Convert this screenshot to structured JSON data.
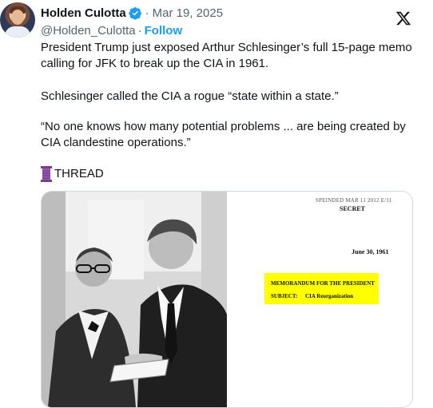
{
  "author": {
    "name": "Holden Culotta",
    "handle": "@Holden_Culotta",
    "date": "Mar 19, 2025",
    "follow_label": "Follow",
    "separator": "·"
  },
  "tweet": {
    "p1": "President Trump just exposed Arthur Schlesinger’s full 15-page memo calling for JFK to break up the CIA in 1961.",
    "p2": "Schlesinger called the CIA a rogue “state within a state.”",
    "p3": "“No one knows how many potential problems ... are being created by CIA clandestine operations.”",
    "thread": "THREAD"
  },
  "media": {
    "doc_header": "SPEINDED MAR 11 2012 E/11",
    "classification": "SECRET",
    "doc_date": "June 30, 1961",
    "memo_title": "MEMORANDUM FOR THE PRESIDENT",
    "memo_subject_label": "SUBJECT:",
    "memo_subject": "CIA Reorganization"
  },
  "colors": {
    "text": "#0f1419",
    "muted": "#536471",
    "accent": "#1d9bf0",
    "highlight": "#ffff00"
  },
  "icons": [
    "verified-badge-icon",
    "x-logo-icon",
    "thread-spool-icon"
  ]
}
